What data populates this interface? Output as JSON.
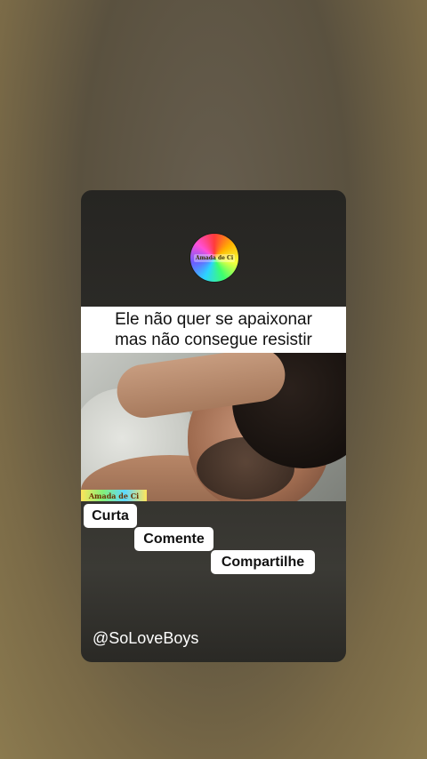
{
  "logo": {
    "text": "Amada de Ci",
    "icon": "rainbow-circle-logo-icon"
  },
  "caption": {
    "line1": "Ele não quer se apaixonar",
    "line2": "mas não consegue resistir"
  },
  "video": {
    "watermark": "Amada de Ci"
  },
  "actions": {
    "like_label": "Curta",
    "comment_label": "Comente",
    "share_label": "Compartilhe"
  },
  "handle": "@SoLoveBoys"
}
